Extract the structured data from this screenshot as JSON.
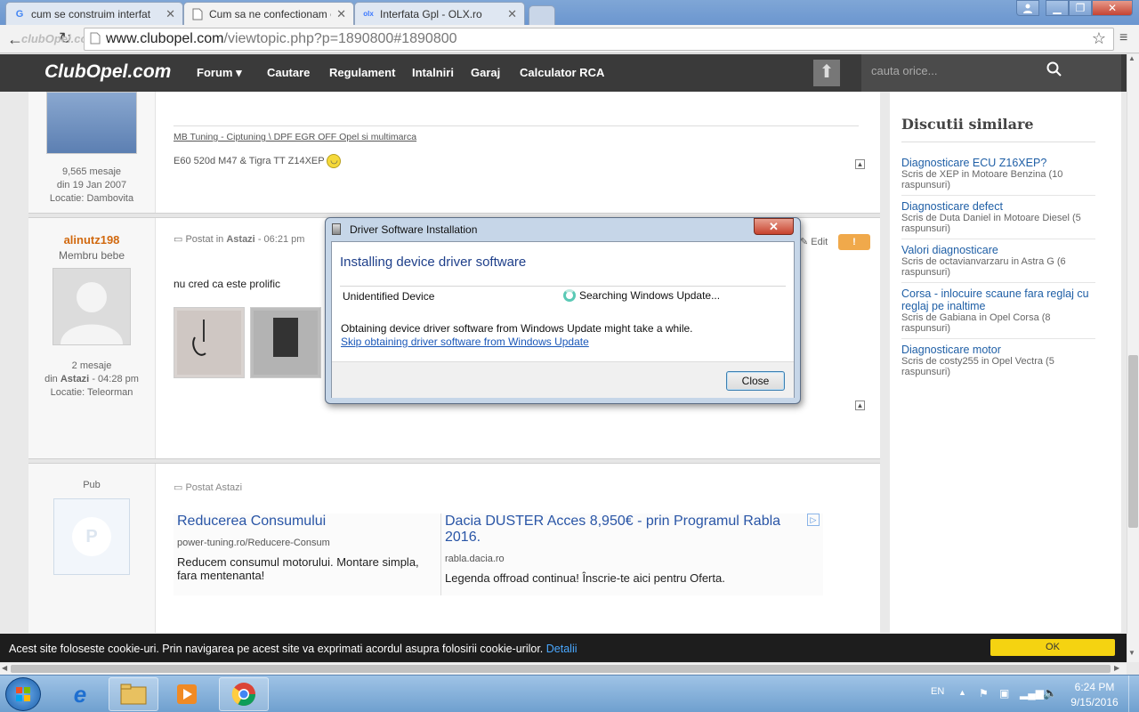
{
  "browser": {
    "tabs": [
      {
        "label": "cum se construim interfat",
        "favicon": "G",
        "favicon_color": "#4285f4"
      },
      {
        "label": "Cum sa ne confectionam c",
        "favicon": "page-icon"
      },
      {
        "label": "Interfata Gpl - OLX.ro",
        "favicon": "olx",
        "favicon_color": "#3a77ff"
      }
    ],
    "url_host": "www.clubopel.com",
    "url_path": "/viewtopic.php?p=1890800#1890800",
    "url_overlay": "clubOpel.com"
  },
  "site": {
    "logo": "ClubOpel.com",
    "nav": [
      "Forum",
      "Cautare",
      "Regulament",
      "Intalniri",
      "Garaj",
      "Calculator RCA"
    ],
    "search_placeholder": "cauta orice..."
  },
  "post1": {
    "stats": "9,565 mesaje",
    "since": "din 19 Jan 2007",
    "location": "Locatie: Dambovita",
    "sig_link": "MB Tuning - Ciptuning \\ DPF EGR OFF Opel si multimarca",
    "sig_text": "E60 520d M47 & Tigra TT Z14XEP"
  },
  "post2": {
    "author": "alinutz198",
    "rank": "Membru bebe",
    "posted_prefix": "Postat in",
    "posted_when": "Astazi",
    "posted_time": "- 06:21 pm",
    "edit_label": "Edit",
    "body": "nu cred ca este prolific",
    "stats": "2 mesaje",
    "since_prefix": "din",
    "since_when": "Astazi",
    "since_time": "- 04:28 pm",
    "location": "Locatie: Teleorman"
  },
  "post3": {
    "author": "Pub",
    "posted": "Postat Astazi",
    "avatar_letter": "P",
    "ads": [
      {
        "title": "Reducerea Consumului",
        "url": "power-tuning.ro/Reducere-Consum",
        "body": "Reducem consumul motorului. Montare simpla, fara mentenanta!"
      },
      {
        "title": "Dacia DUSTER Acces 8,950€ - prin Programul Rabla 2016.",
        "url": "rabla.dacia.ro",
        "body": "Legenda offroad continua! Înscrie-te aici pentru Oferta."
      }
    ]
  },
  "sidebar": {
    "title": "Discutii similare",
    "items": [
      {
        "link": "Diagnosticare ECU Z16XEP?",
        "sub": "Scris de XEP in Motoare Benzina (10 raspunsuri)"
      },
      {
        "link": "Diagnosticare defect",
        "sub": "Scris de Duta Daniel in Motoare Diesel (5 raspunsuri)"
      },
      {
        "link": "Valori diagnosticare",
        "sub": "Scris de octavianvarzaru in Astra G (6 raspunsuri)"
      },
      {
        "link": "Corsa - inlocuire scaune fara reglaj cu reglaj pe inaltime",
        "sub": "Scris de Gabiana in Opel Corsa (8 raspunsuri)"
      },
      {
        "link": "Diagnosticare motor",
        "sub": "Scris de costy255 in Opel Vectra (5 raspunsuri)"
      }
    ]
  },
  "dialog": {
    "title": "Driver Software Installation",
    "heading": "Installing device driver software",
    "device": "Unidentified Device",
    "status": "Searching Windows Update...",
    "info": "Obtaining device driver software from Windows Update might take a while.",
    "skip_link": "Skip obtaining driver software from Windows Update",
    "close_label": "Close"
  },
  "cookie": {
    "text": "Acest site foloseste cookie-uri. Prin navigarea pe acest site va exprimati acordul asupra folosirii cookie-urilor.",
    "link": "Detalii",
    "ok": "OK"
  },
  "taskbar": {
    "lang": "EN",
    "time": "6:24 PM",
    "date": "9/15/2016"
  }
}
